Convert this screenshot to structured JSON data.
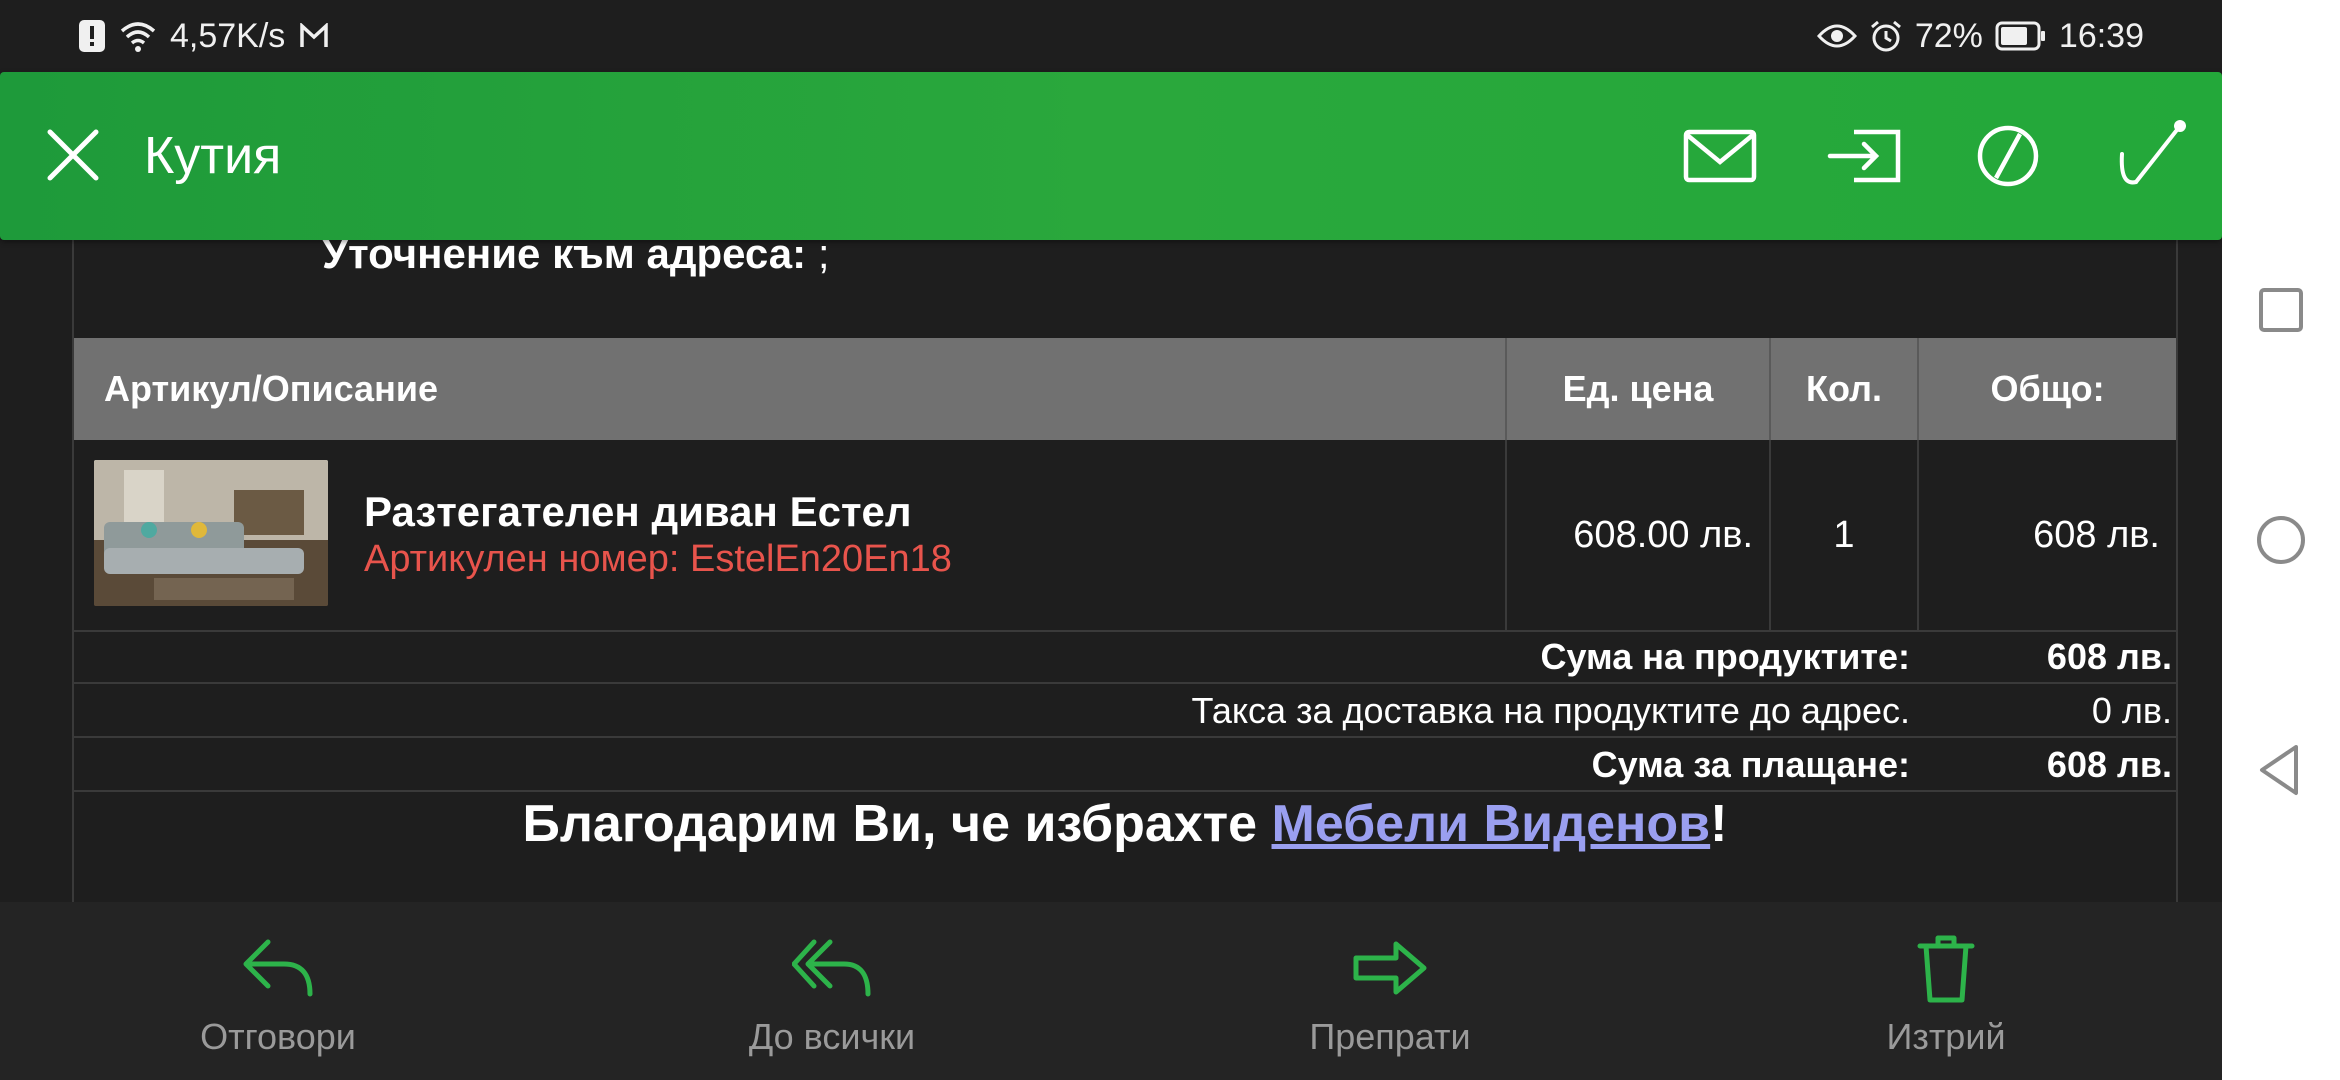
{
  "status_bar": {
    "speed": "4,57K/s",
    "battery": "72%",
    "time": "16:39"
  },
  "toolbar": {
    "title": "Кутия",
    "icons": [
      "close-icon",
      "mark-unread-icon",
      "move-icon",
      "spam-icon",
      "flag-icon"
    ]
  },
  "email": {
    "address_note_label": "Уточнение към адреса:",
    "address_note_value": " ;",
    "table": {
      "headers": [
        "Артикул/Описание",
        "Ед. цена",
        "Кол.",
        "Общо:"
      ],
      "rows": [
        {
          "name": "Разтегателен диван Естел",
          "sku": "Артикулен номер: EstelEn20En18",
          "unit_price": "608.00 лв.",
          "qty": "1",
          "total": "608 лв."
        }
      ]
    },
    "summary": {
      "products_label": "Сума на продуктите:",
      "products_value": "608 лв.",
      "delivery_label": "Такса за доставка на продуктите до адрес.",
      "delivery_value": "0 лв.",
      "total_label": "Сума за плащане:",
      "total_value": "608 лв."
    },
    "thanks_prefix": "Благодарим Ви, че избрахте ",
    "thanks_link": "Мебели Виденов",
    "thanks_suffix": "!"
  },
  "bottom_bar": {
    "reply": "Отговори",
    "reply_all": "До всички",
    "forward": "Препрати",
    "delete": "Изтрий"
  },
  "colors": {
    "toolbar_green": "#22a33a",
    "action_green": "#2db34a",
    "sku_red": "#e8544c",
    "link": "#9a9ff0"
  }
}
